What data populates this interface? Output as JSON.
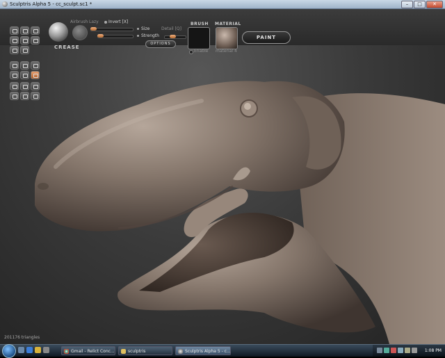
{
  "window": {
    "title": "Sculptris Alpha 5 - cc_sculpt.sc1 *"
  },
  "toolbar": {
    "brush_name": "CREASE",
    "airbrush_label": "Airbrush",
    "lazy_label": "Lazy",
    "invert_label": "Invert [X]",
    "size_label": "Size",
    "detail_label": "Detail [Q]",
    "strength_label": "Strength",
    "options_label": "OPTIONS",
    "size_value": 0.08,
    "strength_value": 0.12,
    "detail_value": 0.5
  },
  "brush": {
    "title": "BRUSH",
    "enable_label": "Enable"
  },
  "material": {
    "title": "MATERIAL",
    "name": "material 4"
  },
  "paint": {
    "label": "PAINT"
  },
  "status": {
    "triangles": "201176 triangles"
  },
  "taskbar": {
    "tasks": [
      {
        "label": "Gmail - Relict Conc...",
        "icon": "chrome-icon"
      },
      {
        "label": "sculptris",
        "icon": "folder-icon"
      },
      {
        "label": "Sculptris Alpha 5 - c...",
        "icon": "sculptris-icon",
        "active": true
      }
    ],
    "clock": "1:08 PM"
  },
  "colors": {
    "accent": "#c0703a",
    "model": "#8a7b70",
    "background": "#3a3a3a"
  }
}
